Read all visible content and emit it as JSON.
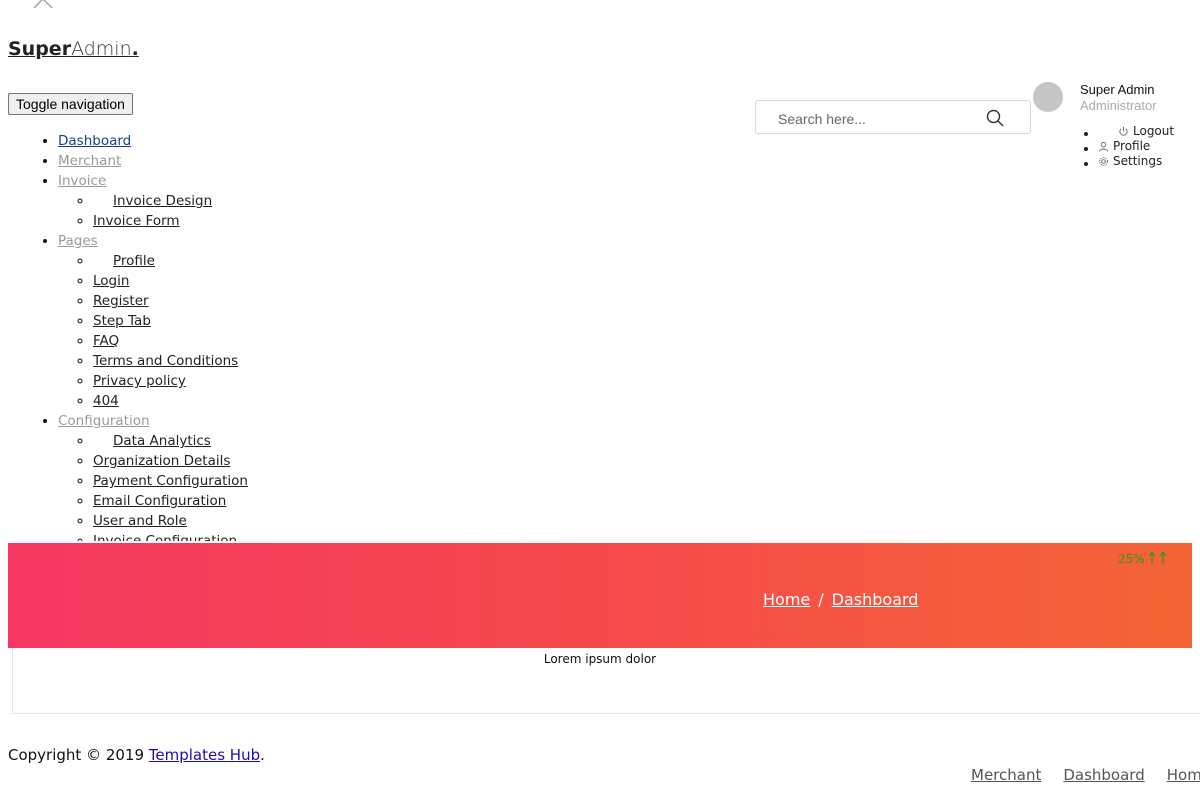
{
  "brand": {
    "bold": "Super",
    "light": "Admin",
    "dot": "."
  },
  "header": {
    "toggle_label": "Toggle navigation",
    "search_placeholder": "Search here..."
  },
  "user": {
    "name": "Super Admin",
    "role": "Administrator",
    "menu": [
      {
        "label": "Logout",
        "icon": "power-icon"
      },
      {
        "label": "Profile",
        "icon": "user-icon"
      },
      {
        "label": "Settings",
        "icon": "gear-icon"
      }
    ]
  },
  "nav": {
    "dashboard": "Dashboard",
    "merchant": "Merchant",
    "invoice": {
      "label": "Invoice",
      "items": [
        "Invoice Design",
        "Invoice Form"
      ]
    },
    "pages": {
      "label": "Pages",
      "items": [
        "Profile",
        "Login",
        "Register",
        "Step Tab",
        "FAQ",
        "Terms and Conditions",
        "Privacy policy",
        "404"
      ]
    },
    "configuration": {
      "label": "Configuration",
      "items": [
        "Data Analytics",
        "Organization Details",
        "Payment Configuration",
        "Email Configuration",
        "User and Role",
        "Invoice Configuration"
      ]
    }
  },
  "banner": {
    "breadcrumb": [
      "Home",
      "Dashboard"
    ],
    "separator": "/",
    "stat": "25%"
  },
  "card": {
    "text": "Lorem ipsum dolor"
  },
  "footer": {
    "copyright_prefix": "Copyright © 2019 ",
    "company_link": "Templates Hub",
    "copyright_suffix": ".",
    "links": [
      "Merchant",
      "Dashboard",
      "Home"
    ]
  },
  "colors": {
    "banner_start": "#f53762",
    "banner_end": "#f46435",
    "active_link": "#1a3d8f",
    "muted_link": "#9a9a9a",
    "stat_green": "#2b9a1f"
  }
}
